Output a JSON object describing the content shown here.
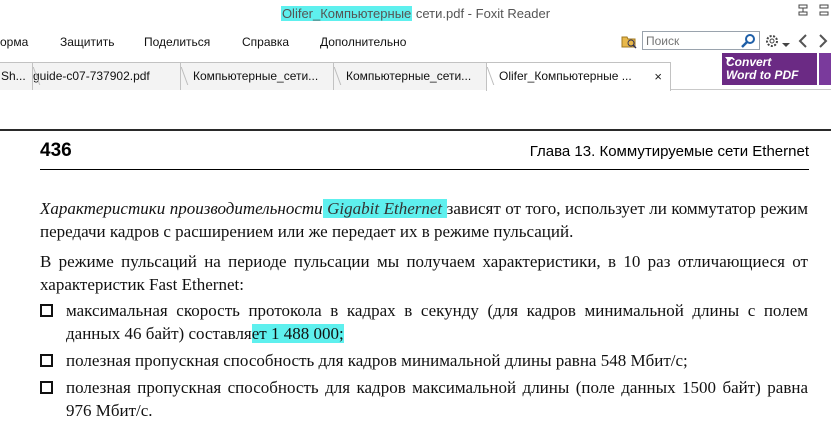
{
  "window": {
    "title_highlight": "Olifer_Компьютерные",
    "title_rest": " сети.pdf - Foxit Reader"
  },
  "menu": {
    "items": [
      "орма",
      "Защитить",
      "Поделиться",
      "Справка",
      "Дополнительно"
    ]
  },
  "search": {
    "placeholder": "Поиск"
  },
  "tabs": [
    {
      "label": "Sh..."
    },
    {
      "label": "guide-c07-737902.pdf"
    },
    {
      "label": "Компьютерные_сети..."
    },
    {
      "label": "Компьютерные_сети..."
    },
    {
      "label": "Olifer_Компьютерные ..."
    }
  ],
  "tab_close": "×",
  "convert": {
    "line1": "Convert",
    "line2": "Word to PDF"
  },
  "page": {
    "number": "436",
    "chapter": "Глава 13. Коммутируемые сети Ethernet",
    "p1_italic": "Характеристики производительности",
    "p1_highlight": " Gigabit Ethernet ",
    "p1_rest": "зависят от того, использует ли коммутатор режим передачи кадров с расширением или же передает их в режиме пульсаций.",
    "p2": "В режиме пульсаций на периоде пульсации мы получаем характеристики, в 10 раз отличающиеся от характеристик Fast Ethernet:",
    "b1_start": "максимальная скорость протокола в кадрах в секунду (для кадров минимальной длины с полем данных 46 байт) составля",
    "b1_highlight": "ет 1 488 000;",
    "b2": "полезная пропускная способность для кадров минимальной длины равна 548 Мбит/с;",
    "b3": "полезная пропускная способность для кадров максимальной длины (поле данных 1500 байт) равна 976 Мбит/с."
  },
  "colors": {
    "highlight": "#5ef0ee",
    "convert_bg": "#6b2a84"
  }
}
